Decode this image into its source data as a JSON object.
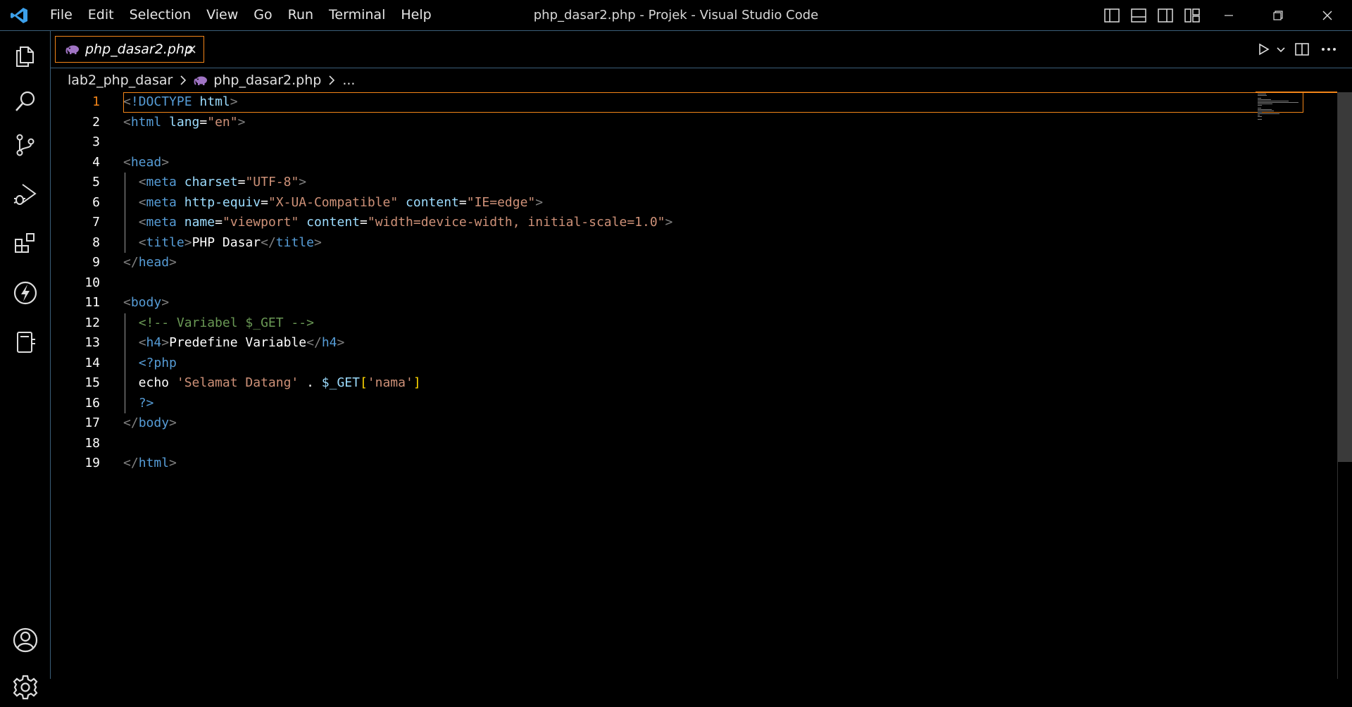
{
  "window": {
    "title": "php_dasar2.php - Projek - Visual Studio Code"
  },
  "menu": [
    "File",
    "Edit",
    "Selection",
    "View",
    "Go",
    "Run",
    "Terminal",
    "Help"
  ],
  "tab": {
    "label": "php_dasar2.php",
    "icon": "php-elephant-icon"
  },
  "breadcrumb": {
    "folder": "lab2_php_dasar",
    "file": "php_dasar2.php",
    "more": "..."
  },
  "editor": {
    "active_line": 1,
    "line_numbers": [
      "1",
      "2",
      "3",
      "4",
      "5",
      "6",
      "7",
      "8",
      "9",
      "10",
      "11",
      "12",
      "13",
      "14",
      "15",
      "16",
      "17",
      "18",
      "19"
    ],
    "lines": [
      [
        [
          "punc",
          "<"
        ],
        [
          "tag",
          "!DOCTYPE"
        ],
        [
          "text",
          " "
        ],
        [
          "attr",
          "html"
        ],
        [
          "punc",
          ">"
        ]
      ],
      [
        [
          "punc",
          "<"
        ],
        [
          "tag",
          "html"
        ],
        [
          "text",
          " "
        ],
        [
          "attr",
          "lang"
        ],
        [
          "text",
          "="
        ],
        [
          "str",
          "\"en\""
        ],
        [
          "punc",
          ">"
        ]
      ],
      [],
      [
        [
          "punc",
          "<"
        ],
        [
          "tag",
          "head"
        ],
        [
          "punc",
          ">"
        ]
      ],
      [
        [
          "text",
          "  "
        ],
        [
          "punc",
          "<"
        ],
        [
          "tag",
          "meta"
        ],
        [
          "text",
          " "
        ],
        [
          "attr",
          "charset"
        ],
        [
          "text",
          "="
        ],
        [
          "str",
          "\"UTF-8\""
        ],
        [
          "punc",
          ">"
        ]
      ],
      [
        [
          "text",
          "  "
        ],
        [
          "punc",
          "<"
        ],
        [
          "tag",
          "meta"
        ],
        [
          "text",
          " "
        ],
        [
          "attr",
          "http-equiv"
        ],
        [
          "text",
          "="
        ],
        [
          "str",
          "\"X-UA-Compatible\""
        ],
        [
          "text",
          " "
        ],
        [
          "attr",
          "content"
        ],
        [
          "text",
          "="
        ],
        [
          "str",
          "\"IE=edge\""
        ],
        [
          "punc",
          ">"
        ]
      ],
      [
        [
          "text",
          "  "
        ],
        [
          "punc",
          "<"
        ],
        [
          "tag",
          "meta"
        ],
        [
          "text",
          " "
        ],
        [
          "attr",
          "name"
        ],
        [
          "text",
          "="
        ],
        [
          "str",
          "\"viewport\""
        ],
        [
          "text",
          " "
        ],
        [
          "attr",
          "content"
        ],
        [
          "text",
          "="
        ],
        [
          "str",
          "\"width=device-width, initial-scale=1.0\""
        ],
        [
          "punc",
          ">"
        ]
      ],
      [
        [
          "text",
          "  "
        ],
        [
          "punc",
          "<"
        ],
        [
          "tag",
          "title"
        ],
        [
          "punc",
          ">"
        ],
        [
          "text",
          "PHP Dasar"
        ],
        [
          "punc",
          "</"
        ],
        [
          "tag",
          "title"
        ],
        [
          "punc",
          ">"
        ]
      ],
      [
        [
          "punc",
          "</"
        ],
        [
          "tag",
          "head"
        ],
        [
          "punc",
          ">"
        ]
      ],
      [],
      [
        [
          "punc",
          "<"
        ],
        [
          "tag",
          "body"
        ],
        [
          "punc",
          ">"
        ]
      ],
      [
        [
          "text",
          "  "
        ],
        [
          "comment",
          "<!-- Variabel $_GET -->"
        ]
      ],
      [
        [
          "text",
          "  "
        ],
        [
          "punc",
          "<"
        ],
        [
          "tag",
          "h4"
        ],
        [
          "punc",
          ">"
        ],
        [
          "text",
          "Predefine Variable"
        ],
        [
          "punc",
          "</"
        ],
        [
          "tag",
          "h4"
        ],
        [
          "punc",
          ">"
        ]
      ],
      [
        [
          "text",
          "  "
        ],
        [
          "php",
          "<?php"
        ]
      ],
      [
        [
          "text",
          "  echo "
        ],
        [
          "str",
          "'Selamat Datang'"
        ],
        [
          "text",
          " . "
        ],
        [
          "var",
          "$_GET"
        ],
        [
          "brk",
          "["
        ],
        [
          "str",
          "'nama'"
        ],
        [
          "brk",
          "]"
        ]
      ],
      [
        [
          "text",
          "  "
        ],
        [
          "php",
          "?>"
        ]
      ],
      [
        [
          "punc",
          "</"
        ],
        [
          "tag",
          "body"
        ],
        [
          "punc",
          ">"
        ]
      ],
      [],
      [
        [
          "punc",
          "</"
        ],
        [
          "tag",
          "html"
        ],
        [
          "punc",
          ">"
        ]
      ]
    ],
    "indented_lines": [
      5,
      6,
      7,
      8,
      12,
      13,
      14,
      15,
      16
    ]
  },
  "colors": {
    "focus_border": "#f38518",
    "window_border": "#3b5f7a",
    "background": "#000000"
  }
}
